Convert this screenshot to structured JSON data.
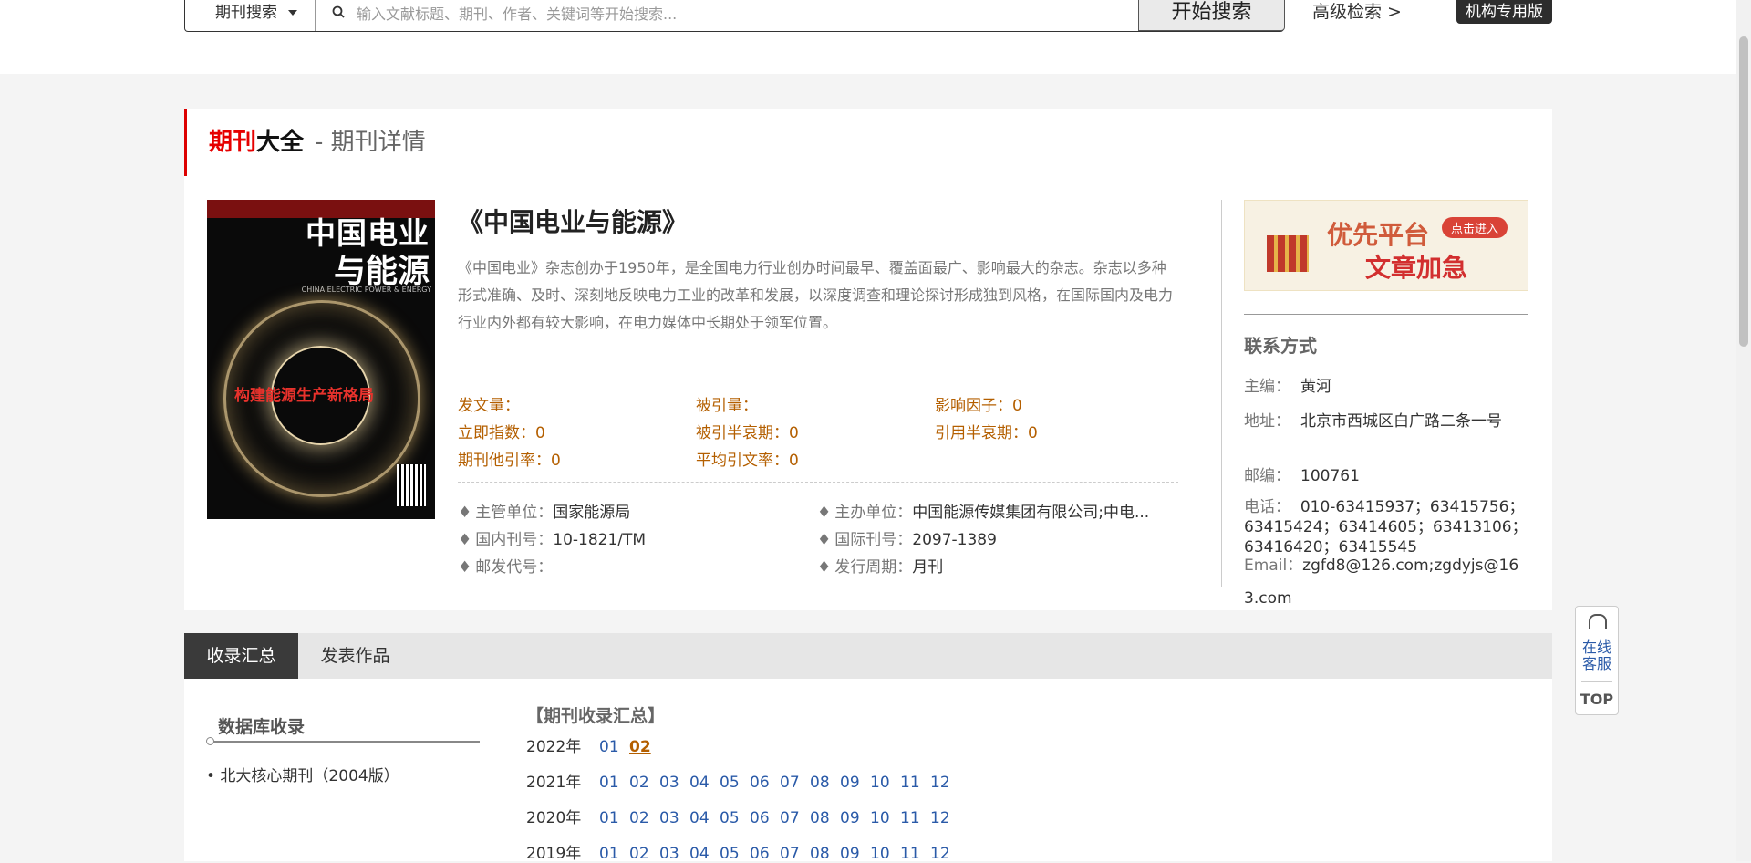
{
  "header": {
    "search_type": "期刊搜索",
    "search_placeholder": "输入文献标题、期刊、作者、关键词等开始搜索...",
    "search_button": "开始搜索",
    "advanced_link": "高级检索 >",
    "institution_button": "机构专用版"
  },
  "section_title": {
    "part1": "期刊",
    "part2": "大全",
    "part3": "- 期刊详情"
  },
  "cover": {
    "title_line1": "中国电业",
    "title_line2": "与能源",
    "english": "CHINA ELECTRIC POWER & ENERGY",
    "slogan": "构建能源生产新格局"
  },
  "journal": {
    "title": "《中国电业与能源》",
    "description": "《中国电业》杂志创办于1950年，是全国电力行业创办时间最早、覆盖面最广、影响最大的杂志。杂志以多种形式准确、及时、深刻地反映电力工业的改革和发展，以深度调查和理论探讨形成独到风格，在国际国内及电力行业内外都有较大影响，在电力媒体中长期处于领军位置。",
    "stats": {
      "fawenliang": "发文量：",
      "beiyinliang": "被引量：",
      "yingxiang": "影响因子：0",
      "liji": "立即指数：0",
      "beiyin_banshuai": "被引半衰期：0",
      "yinyong_banshuai": "引用半衰期：0",
      "tayin": "期刊他引率：0",
      "pingjun": "平均引文率：0"
    },
    "info": {
      "zhuguan_label": "主管单位：",
      "zhuguan_value": "国家能源局",
      "zhuban_label": "主办单位：",
      "zhuban_value": "中国能源传媒集团有限公司;中电...",
      "guonei_label": "国内刊号：",
      "guonei_value": "10-1821/TM",
      "guoji_label": "国际刊号：",
      "guoji_value": "2097-1389",
      "youfa_label": "邮发代号：",
      "youfa_value": "",
      "zhouqi_label": "发行周期：",
      "zhouqi_value": "月刊"
    }
  },
  "ad": {
    "line1": "优先平台",
    "line2": "文章加急",
    "badge": "点击进入"
  },
  "contact": {
    "title": "联系方式",
    "editor_label": "主编：",
    "editor_value": "黄河",
    "address_label": "地址：",
    "address_value": "北京市西城区白广路二条一号",
    "postcode_label": "邮编：",
    "postcode_value": "100761",
    "phone_label": "电话：",
    "phone_value": "010-63415937；63415756；63415424；63414605；63413106；63416420；63415545",
    "email_label": "Email：",
    "email_value": "zgfd8@126.com;zgdyjs@163.com"
  },
  "tabs": {
    "active": "收录汇总",
    "other": "发表作品"
  },
  "database": {
    "title": "数据库收录",
    "item": "• 北大核心期刊（2004版）"
  },
  "summary": {
    "title": "【期刊收录汇总】",
    "years": [
      {
        "year": "2022年",
        "issues": [
          "01",
          "02"
        ]
      },
      {
        "year": "2021年",
        "issues": [
          "01",
          "02",
          "03",
          "04",
          "05",
          "06",
          "07",
          "08",
          "09",
          "10",
          "11",
          "12"
        ]
      },
      {
        "year": "2020年",
        "issues": [
          "01",
          "02",
          "03",
          "04",
          "05",
          "06",
          "07",
          "08",
          "09",
          "10",
          "11",
          "12"
        ]
      },
      {
        "year": "2019年",
        "issues": [
          "01",
          "02",
          "03",
          "04",
          "05",
          "06",
          "07",
          "08",
          "09",
          "10",
          "11",
          "12"
        ]
      }
    ],
    "current_issue": "02"
  },
  "float_service": {
    "service": "在线客服",
    "top": "TOP"
  }
}
